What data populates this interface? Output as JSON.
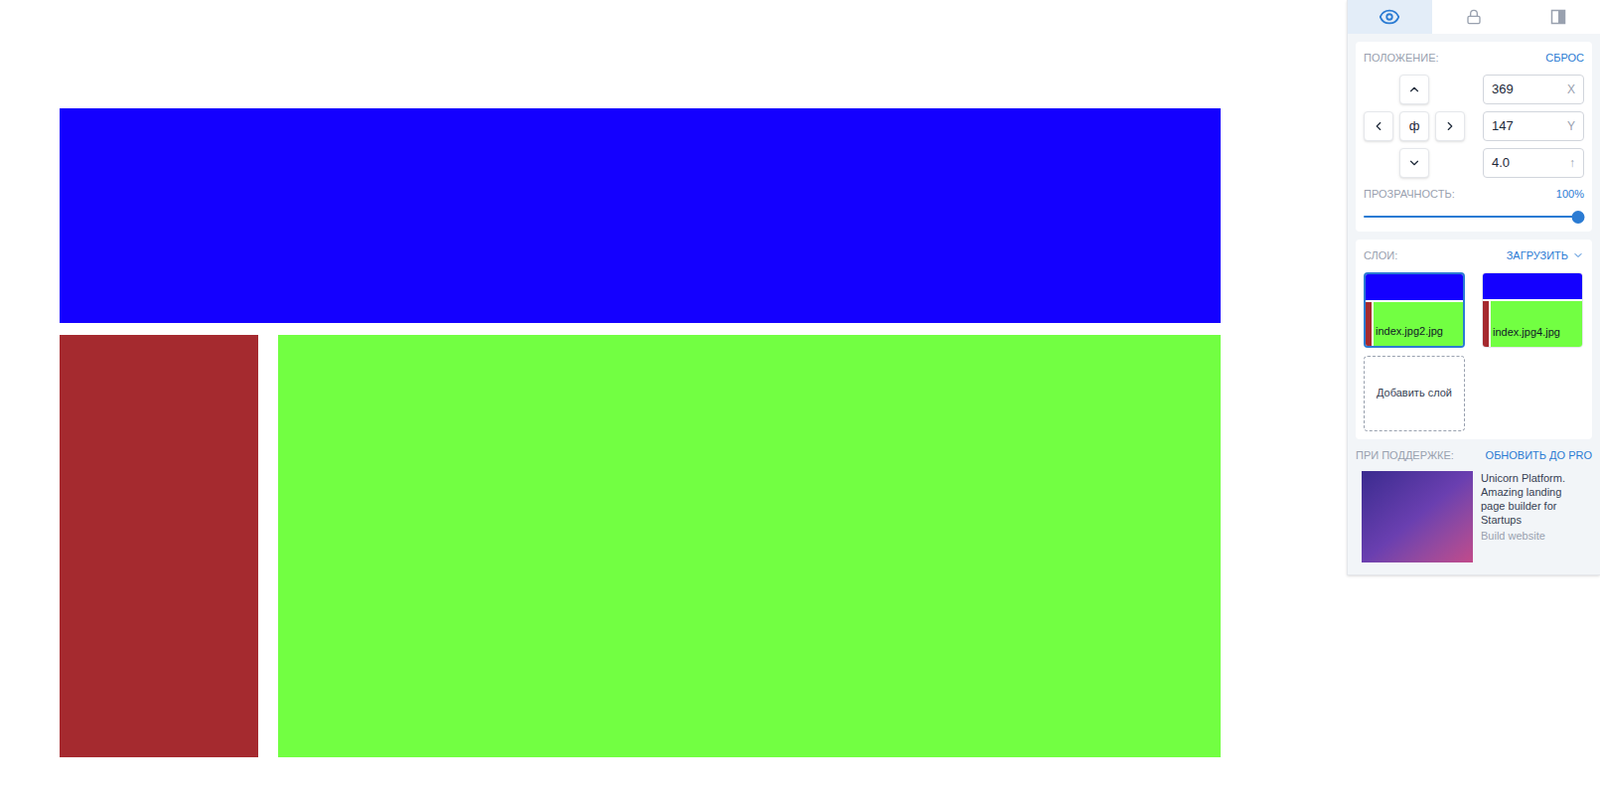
{
  "page": {
    "header_color": "#1400ff",
    "sidebar_color": "#a52a2f",
    "content_color": "#72ff42"
  },
  "panel": {
    "tabs": [
      {
        "kind": "visibility",
        "selected": true
      },
      {
        "kind": "lock",
        "selected": false
      },
      {
        "kind": "invert",
        "selected": false
      }
    ],
    "position": {
      "label": "ПОЛОЖЕНИЕ:",
      "reset": "СБРОС",
      "center": "ф",
      "fields": [
        {
          "value": "369",
          "suffix": "X"
        },
        {
          "value": "147",
          "suffix": "Y"
        },
        {
          "value": "4.0",
          "suffix": "↑"
        }
      ]
    },
    "opacity": {
      "label": "ПРОЗРАЧНОСТЬ:",
      "reading": "100%",
      "level": 1
    },
    "layers": {
      "label": "СЛОИ:",
      "upload": "ЗАГРУЗИТЬ",
      "items": [
        {
          "name": "index.jpg2.jpg",
          "selected": true
        },
        {
          "name": "index.jpg4.jpg",
          "selected": false
        }
      ],
      "add": "Добавить слой"
    },
    "support": {
      "label": "ПРИ ПОДДЕРЖКЕ:",
      "upgrade": "ОБНОВИТЬ ДО PRO",
      "ad": {
        "text": "Unicorn Platform. Amazing landing page builder for Startups",
        "link": "Build website"
      }
    }
  }
}
